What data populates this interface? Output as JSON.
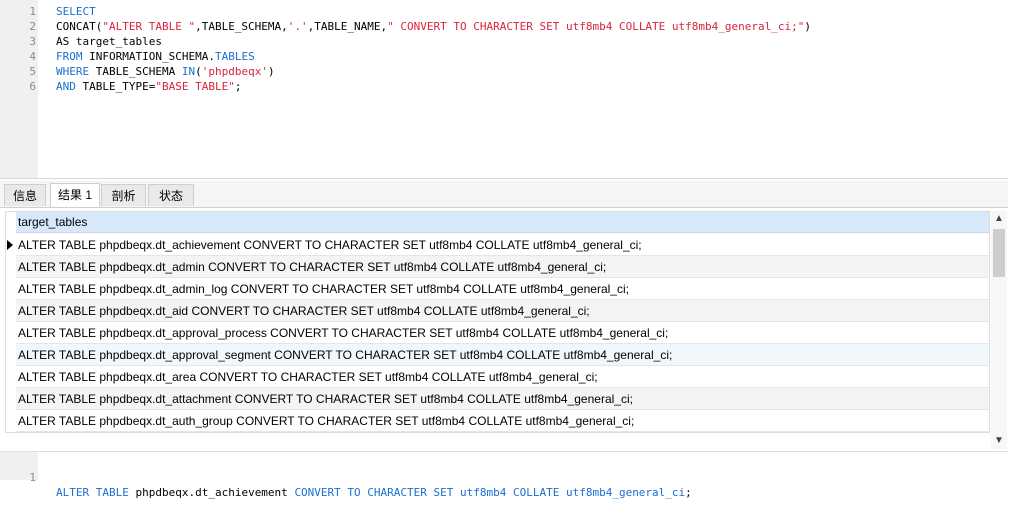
{
  "editor": {
    "lines": [
      {
        "no": "1",
        "parts": [
          {
            "t": "SELECT",
            "c": "kw"
          }
        ]
      },
      {
        "no": "2",
        "parts": [
          {
            "t": "CONCAT(",
            "c": ""
          },
          {
            "t": "\"ALTER TABLE \"",
            "c": "str"
          },
          {
            "t": ",TABLE_SCHEMA,",
            "c": ""
          },
          {
            "t": "'.'",
            "c": "str"
          },
          {
            "t": ",TABLE_NAME,",
            "c": ""
          },
          {
            "t": "\" CONVERT TO CHARACTER SET utf8mb4 COLLATE utf8mb4_general_ci;\"",
            "c": "str"
          },
          {
            "t": ")",
            "c": ""
          }
        ]
      },
      {
        "no": "3",
        "parts": [
          {
            "t": "AS target_tables",
            "c": ""
          }
        ]
      },
      {
        "no": "4",
        "parts": [
          {
            "t": "FROM",
            "c": "kw"
          },
          {
            "t": " INFORMATION_SCHEMA.",
            "c": ""
          },
          {
            "t": "TABLES",
            "c": "kw"
          }
        ]
      },
      {
        "no": "5",
        "parts": [
          {
            "t": "WHERE",
            "c": "kw"
          },
          {
            "t": " TABLE_SCHEMA ",
            "c": ""
          },
          {
            "t": "IN",
            "c": "kw"
          },
          {
            "t": "(",
            "c": ""
          },
          {
            "t": "'phpdbeqx'",
            "c": "str"
          },
          {
            "t": ")",
            "c": ""
          }
        ]
      },
      {
        "no": "6",
        "parts": [
          {
            "t": "AND",
            "c": "kw"
          },
          {
            "t": " TABLE_TYPE=",
            "c": ""
          },
          {
            "t": "\"BASE TABLE\"",
            "c": "str"
          },
          {
            "t": ";",
            "c": ""
          }
        ]
      }
    ]
  },
  "tabs": [
    {
      "label": "信息",
      "active": false
    },
    {
      "label": "结果 1",
      "active": true
    },
    {
      "label": "剖析",
      "active": false
    },
    {
      "label": "状态",
      "active": false
    }
  ],
  "grid": {
    "column": "target_tables",
    "rows": [
      "ALTER TABLE phpdbeqx.dt_achievement CONVERT TO CHARACTER SET utf8mb4 COLLATE utf8mb4_general_ci;",
      "ALTER TABLE phpdbeqx.dt_admin CONVERT TO CHARACTER SET utf8mb4 COLLATE utf8mb4_general_ci;",
      "ALTER TABLE phpdbeqx.dt_admin_log CONVERT TO CHARACTER SET utf8mb4 COLLATE utf8mb4_general_ci;",
      "ALTER TABLE phpdbeqx.dt_aid CONVERT TO CHARACTER SET utf8mb4 COLLATE utf8mb4_general_ci;",
      "ALTER TABLE phpdbeqx.dt_approval_process CONVERT TO CHARACTER SET utf8mb4 COLLATE utf8mb4_general_ci;",
      "ALTER TABLE phpdbeqx.dt_approval_segment CONVERT TO CHARACTER SET utf8mb4 COLLATE utf8mb4_general_ci;",
      "ALTER TABLE phpdbeqx.dt_area CONVERT TO CHARACTER SET utf8mb4 COLLATE utf8mb4_general_ci;",
      "ALTER TABLE phpdbeqx.dt_attachment CONVERT TO CHARACTER SET utf8mb4 COLLATE utf8mb4_general_ci;",
      "ALTER TABLE phpdbeqx.dt_auth_group CONVERT TO CHARACTER SET utf8mb4 COLLATE utf8mb4_general_ci;"
    ]
  },
  "scrollbar": {
    "up_icon": "▲",
    "down_icon": "▼",
    "up_name": "chevron-up-icon",
    "down_name": "chevron-down-icon"
  },
  "preview": {
    "no": "1",
    "parts": [
      {
        "t": "ALTER TABLE",
        "c": "kw"
      },
      {
        "t": " phpdbeqx.dt_achievement ",
        "c": ""
      },
      {
        "t": "CONVERT TO CHARACTER SET utf8mb4 COLLATE utf8mb4_general_ci",
        "c": "kw"
      },
      {
        "t": ";",
        "c": ""
      }
    ]
  },
  "colors": {
    "keyword": "#1a6fd1",
    "string": "#d8243c",
    "header": "#d6e8fa"
  }
}
